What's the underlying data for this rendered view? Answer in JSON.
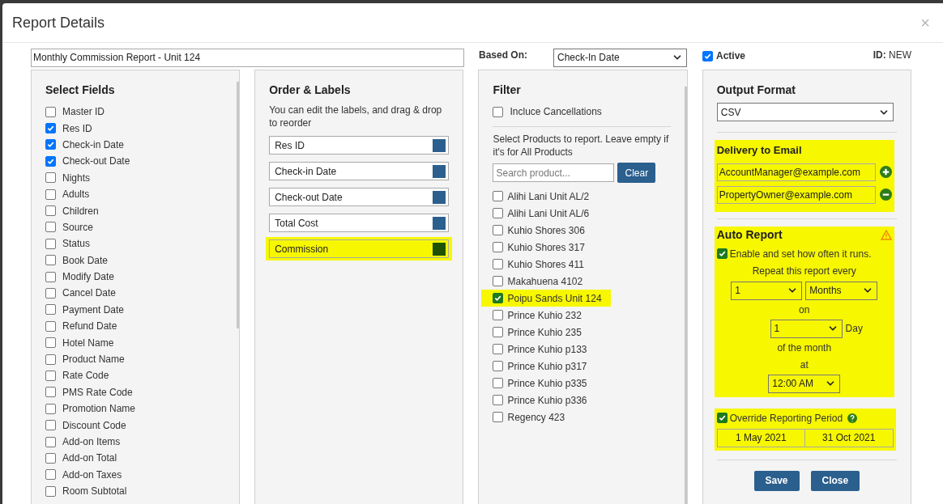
{
  "window": {
    "title": "Report Details",
    "close": "×"
  },
  "report_name": {
    "value": "Monthly Commission Report - Unit 124"
  },
  "based_on": {
    "label": "Based On:",
    "value": "Check-In Date"
  },
  "active": {
    "label": "Active",
    "checked": true
  },
  "id": {
    "label": "ID:",
    "value": "NEW"
  },
  "select_fields": {
    "title": "Select Fields",
    "items": [
      {
        "label": "Master ID",
        "checked": false
      },
      {
        "label": "Res ID",
        "checked": true
      },
      {
        "label": "Check-in Date",
        "checked": true
      },
      {
        "label": "Check-out Date",
        "checked": true
      },
      {
        "label": "Nights",
        "checked": false
      },
      {
        "label": "Adults",
        "checked": false
      },
      {
        "label": "Children",
        "checked": false
      },
      {
        "label": "Source",
        "checked": false
      },
      {
        "label": "Status",
        "checked": false
      },
      {
        "label": "Book Date",
        "checked": false
      },
      {
        "label": "Modify Date",
        "checked": false
      },
      {
        "label": "Cancel Date",
        "checked": false
      },
      {
        "label": "Payment Date",
        "checked": false
      },
      {
        "label": "Refund Date",
        "checked": false
      },
      {
        "label": "Hotel Name",
        "checked": false
      },
      {
        "label": "Product Name",
        "checked": false
      },
      {
        "label": "Rate Code",
        "checked": false
      },
      {
        "label": "PMS Rate Code",
        "checked": false
      },
      {
        "label": "Promotion Name",
        "checked": false
      },
      {
        "label": "Discount Code",
        "checked": false
      },
      {
        "label": "Add-on Items",
        "checked": false
      },
      {
        "label": "Add-on Total",
        "checked": false
      },
      {
        "label": "Add-on Taxes",
        "checked": false
      },
      {
        "label": "Room Subtotal",
        "checked": false
      }
    ]
  },
  "order_labels": {
    "title": "Order & Labels",
    "description": "You can edit the labels, and drag & drop to reorder",
    "items": [
      {
        "label": "Res ID",
        "color": "#2b5f8e",
        "highlighted": false
      },
      {
        "label": "Check-in Date",
        "color": "#2b5f8e",
        "highlighted": false
      },
      {
        "label": "Check-out Date",
        "color": "#2b5f8e",
        "highlighted": false
      },
      {
        "label": "Total Cost",
        "color": "#2b5f8e",
        "highlighted": false
      },
      {
        "label": "Commission",
        "color": "#1f5200",
        "highlighted": true
      }
    ]
  },
  "filter": {
    "title": "Filter",
    "include_cancellations": {
      "label": "Incluce Cancellations",
      "checked": false
    },
    "description": "Select Products to report. Leave empty if it's for All Products",
    "search": {
      "placeholder": "Search product..."
    },
    "clear_button": "Clear",
    "products": [
      {
        "label": "Alihi Lani Unit AL/2",
        "checked": false,
        "highlighted": false
      },
      {
        "label": "Alihi Lani Unit AL/6",
        "checked": false,
        "highlighted": false
      },
      {
        "label": "Kuhio Shores 306",
        "checked": false,
        "highlighted": false
      },
      {
        "label": "Kuhio Shores 317",
        "checked": false,
        "highlighted": false
      },
      {
        "label": "Kuhio Shores 411",
        "checked": false,
        "highlighted": false
      },
      {
        "label": "Makahuena 4102",
        "checked": false,
        "highlighted": false
      },
      {
        "label": "Poipu Sands Unit 124",
        "checked": true,
        "highlighted": true
      },
      {
        "label": "Prince Kuhio 232",
        "checked": false,
        "highlighted": false
      },
      {
        "label": "Prince Kuhio 235",
        "checked": false,
        "highlighted": false
      },
      {
        "label": "Prince Kuhio p133",
        "checked": false,
        "highlighted": false
      },
      {
        "label": "Prince Kuhio p317",
        "checked": false,
        "highlighted": false
      },
      {
        "label": "Prince Kuhio p335",
        "checked": false,
        "highlighted": false
      },
      {
        "label": "Prince Kuhio p336",
        "checked": false,
        "highlighted": false
      },
      {
        "label": "Regency 423",
        "checked": false,
        "highlighted": false
      }
    ]
  },
  "output": {
    "title": "Output Format",
    "format": "CSV",
    "delivery": {
      "title": "Delivery to Email",
      "highlighted": true,
      "emails": [
        {
          "value": "AccountManager@example.com",
          "kind": "add"
        },
        {
          "value": "PropertyOwner@example.com",
          "kind": "remove"
        }
      ]
    },
    "auto_report": {
      "title": "Auto Report",
      "highlighted": true,
      "warning": true,
      "enabled": {
        "label": "Enable and set how often it runs.",
        "checked": true
      },
      "repeat_label": "Repeat this report every",
      "interval": "1",
      "unit": "Months",
      "on_label": "on",
      "day": "1",
      "day_label": "Day",
      "of_month_label": "of the month",
      "at_label": "at",
      "time": "12:00 AM"
    },
    "override": {
      "label": "Override Reporting Period",
      "checked": true,
      "highlighted": true,
      "from": "1 May 2021",
      "to": "31 Oct 2021"
    },
    "buttons": [
      "Save",
      "Close"
    ]
  }
}
